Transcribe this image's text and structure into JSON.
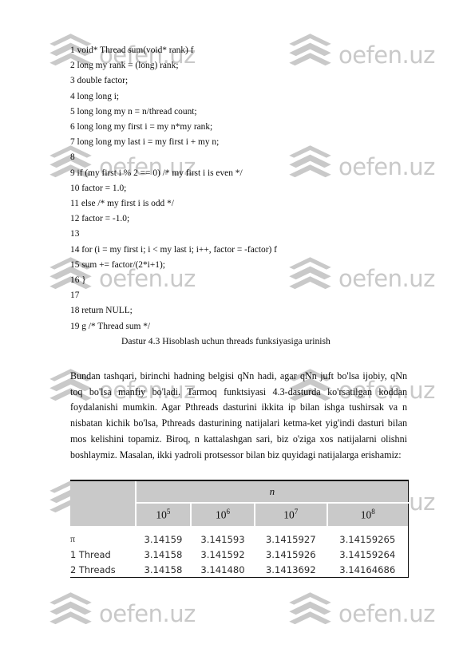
{
  "watermark": {
    "text": "oefen.uz",
    "logo_icon": "stacked-diamond-logo",
    "color": "#c9c9c9"
  },
  "code_listing": {
    "name": "pthreads-thread-sum-listing",
    "lines": [
      "1 void* Thread sum(void* rank) f",
      "2 long my rank = (long) rank;",
      "3 double factor;",
      "4 long long i;",
      "5 long long my n = n/thread count;",
      "6 long long my first i = my n*my rank;",
      "7 long long my last i = my first i + my n;",
      "8",
      "9 if (my first i % 2 == 0) /* my first i is even */",
      "10 factor = 1.0;",
      "11 else /* my first i is odd */",
      "12 factor = -1.0;",
      "13",
      "14 for (i = my first i; i < my last i; i++, factor = -factor) f",
      "15 sum += factor/(2*i+1);",
      "16 }",
      "17",
      "18 return NULL;",
      "19 g /* Thread sum */"
    ]
  },
  "caption": {
    "text": "Dastur 4.3  Hisoblash uchun threads funksiyasiga urinish"
  },
  "paragraph": {
    "text": "Bundan tashqari, birinchi hadning belgisi qNn hadi, agar qNn juft bo'lsa ijobiy, qNn toq bo'lsa manfiy bo'ladi. Tarmoq funktsiyasi 4.3-dasturda ko'rsatilgan koddan foydalanishi mumkin. Agar Pthreads dasturini ikkita ip bilan ishga tushirsak va n nisbatan kichik bo'lsa, Pthreads dasturining natijalari ketma-ket yig'indi dasturi bilan mos kelishini topamiz. Biroq, n kattalashgan sari, biz o'ziga xos natijalarni olishni boshlaymiz. Masalan, ikki yadroli protsessor bilan biz quyidagi natijalarga erishamiz:"
  },
  "results_table": {
    "name": "pi-estimates-table",
    "group_header": "n",
    "corner_label": "",
    "column_headers": [
      {
        "base": "10",
        "exp": "5"
      },
      {
        "base": "10",
        "exp": "6"
      },
      {
        "base": "10",
        "exp": "7"
      },
      {
        "base": "10",
        "exp": "8"
      }
    ],
    "rows": [
      {
        "label": "π",
        "values": [
          "3.14159",
          "3.141593",
          "3.1415927",
          "3.14159265"
        ]
      },
      {
        "label": "1 Thread",
        "values": [
          "3.14158",
          "3.141592",
          "3.1415926",
          "3.14159264"
        ]
      },
      {
        "label": "2 Threads",
        "values": [
          "3.14158",
          "3.141480",
          "3.1413692",
          "3.14164686"
        ]
      }
    ],
    "header_bg": "#c9c9c9",
    "rule_color": "#111111"
  }
}
